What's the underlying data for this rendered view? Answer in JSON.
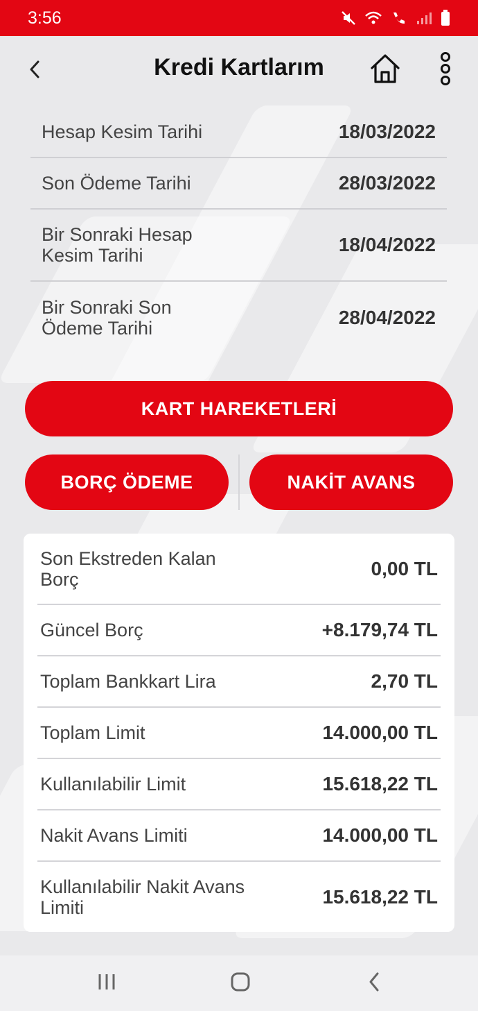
{
  "status_bar": {
    "time": "3:56",
    "bg_color": "#e30613"
  },
  "header": {
    "title": "Kredi Kartlarım"
  },
  "info_rows": [
    {
      "label": "Hesap Kesim Tarihi",
      "value": "18/03/2022"
    },
    {
      "label": "Son Ödeme Tarihi",
      "value": "28/03/2022"
    },
    {
      "label": "Bir Sonraki Hesap Kesim Tarihi",
      "value": "18/04/2022"
    },
    {
      "label": "Bir Sonraki Son Ödeme Tarihi",
      "value": "28/04/2022"
    }
  ],
  "buttons": {
    "kart_hareketleri": "KART HAREKETLERİ",
    "borc_odeme": "BORÇ ÖDEME",
    "nakit_avans": "NAKİT AVANS"
  },
  "summary_rows": [
    {
      "label": "Son Ekstreden Kalan Borç",
      "value": "0,00 TL"
    },
    {
      "label": "Güncel Borç",
      "value": "+8.179,74 TL"
    },
    {
      "label": "Toplam Bankkart Lira",
      "value": "2,70 TL"
    },
    {
      "label": "Toplam Limit",
      "value": "14.000,00 TL"
    },
    {
      "label": "Kullanılabilir Limit",
      "value": "15.618,22 TL"
    },
    {
      "label": "Nakit Avans Limiti",
      "value": "14.000,00 TL"
    },
    {
      "label": "Kullanılabilir Nakit Avans Limiti",
      "value": "15.618,22 TL"
    }
  ],
  "icons": {
    "back": "chevron-left-icon",
    "home": "home-icon",
    "more": "more-vertical-icon",
    "nav_recents": "recents-icon",
    "nav_home": "nav-home-icon",
    "nav_back": "nav-back-icon"
  },
  "colors": {
    "accent": "#e30613",
    "background": "#e9e9eb",
    "card": "#ffffff"
  }
}
